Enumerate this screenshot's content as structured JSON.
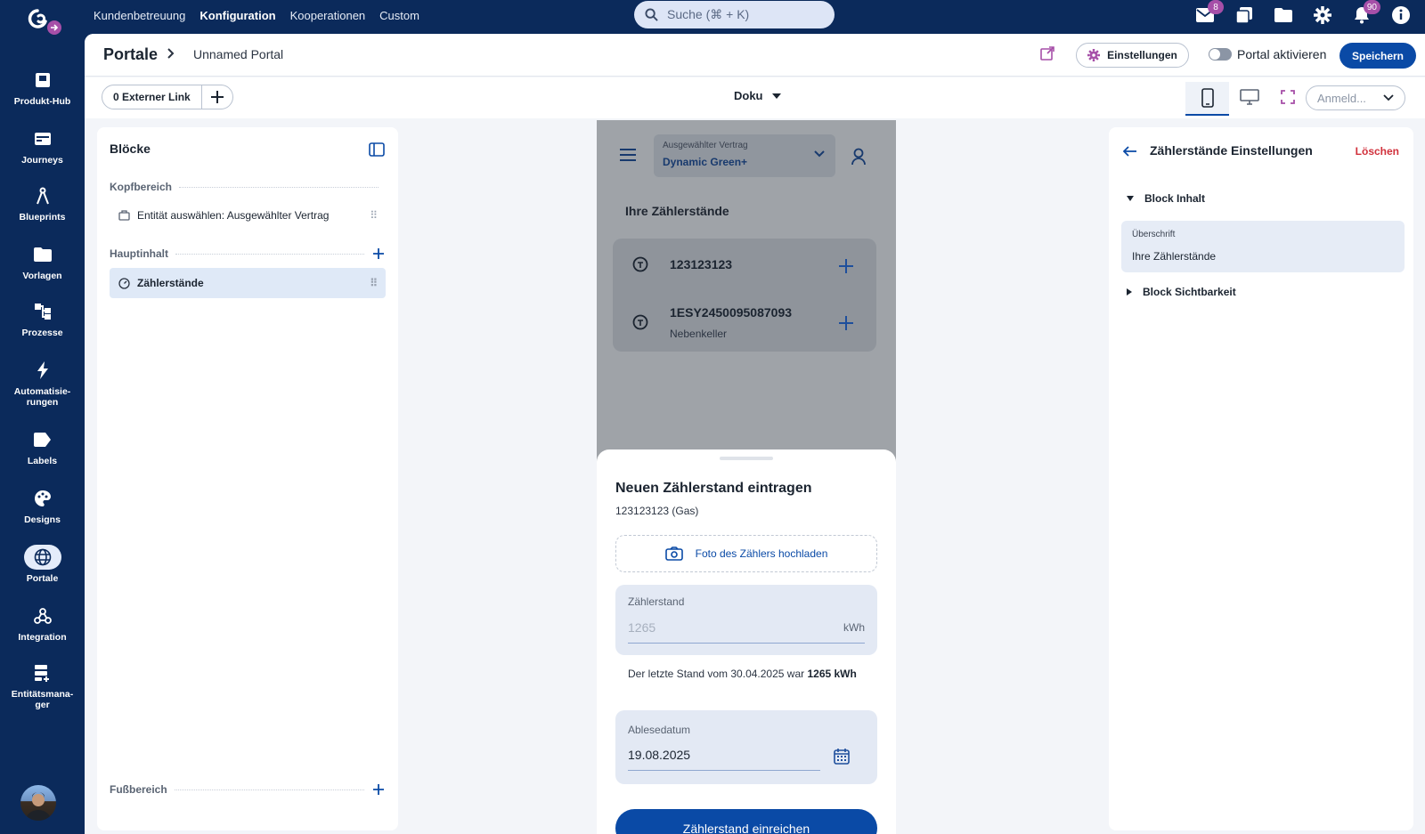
{
  "topnav": {
    "items": [
      "Kundenbetreuung",
      "Konfiguration",
      "Kooperationen",
      "Custom"
    ],
    "active_index": 1
  },
  "search": {
    "placeholder": "Suche (⌘ + K)"
  },
  "top_icons": {
    "mail_badge": "8",
    "notifications_badge": "90"
  },
  "sidebar": {
    "items": [
      {
        "label": "Produkt-Hub",
        "icon": "product-hub-icon"
      },
      {
        "label": "Journeys",
        "icon": "journeys-icon"
      },
      {
        "label": "Blueprints",
        "icon": "blueprints-icon"
      },
      {
        "label": "Vorlagen",
        "icon": "folder-icon"
      },
      {
        "label": "Prozesse",
        "icon": "processes-icon"
      },
      {
        "label": "Automatisie-rungen",
        "icon": "lightning-icon"
      },
      {
        "label": "Labels",
        "icon": "label-icon"
      },
      {
        "label": "Designs",
        "icon": "palette-icon"
      },
      {
        "label": "Portale",
        "icon": "globe-icon",
        "selected": true
      },
      {
        "label": "Integration",
        "icon": "webhook-icon"
      },
      {
        "label": "Entitätsmana-ger",
        "icon": "entity-icon"
      }
    ]
  },
  "header": {
    "title": "Portale",
    "page": "Unnamed Portal",
    "settings_label": "Einstellungen",
    "activate_label": "Portal aktivieren",
    "activate_on": false,
    "save_label": "Speichern"
  },
  "toolbar": {
    "external_link_label": "0 Externer Link",
    "page_select": "Doku",
    "login_select_placeholder": "Anmeld..."
  },
  "blocks_panel": {
    "title": "Blöcke",
    "sections": {
      "header": "Kopfbereich",
      "main": "Hauptinhalt",
      "footer": "Fußbereich"
    },
    "header_blocks": [
      "Entität auswählen: Ausgewählter Vertrag"
    ],
    "main_blocks": [
      "Zählerstände"
    ]
  },
  "preview": {
    "contract_select_label": "Ausgewählter Vertrag",
    "contract_select_value": "Dynamic Green+",
    "heading": "Ihre Zählerstände",
    "meters": [
      {
        "number": "123123123",
        "note": ""
      },
      {
        "number": "1ESY2450095087093",
        "note": "Nebenkeller"
      }
    ],
    "sheet": {
      "title": "Neuen Zählerstand eintragen",
      "subtitle": "123123123 (Gas)",
      "upload_label": "Foto des Zählers hochladen",
      "reading_label": "Zählerstand",
      "reading_placeholder": "1265",
      "reading_unit": "kWh",
      "hint_text": "Der letzte Stand vom 30.04.2025 war",
      "hint_value": "1265 kWh",
      "date_label": "Ablesedatum",
      "date_value": "19.08.2025",
      "submit_label": "Zählerstand einreichen"
    }
  },
  "settings_panel": {
    "title": "Zählerstände Einstellungen",
    "delete_label": "Löschen",
    "content_section": "Block Inhalt",
    "heading_field_label": "Überschrift",
    "heading_field_value": "Ihre Zählerstände",
    "visibility_section": "Block Sichtbarkeit"
  },
  "colors": {
    "navy": "#0b2a5b",
    "primary": "#0a4aa6",
    "badge": "#a64fa8",
    "danger": "#d1313c"
  }
}
